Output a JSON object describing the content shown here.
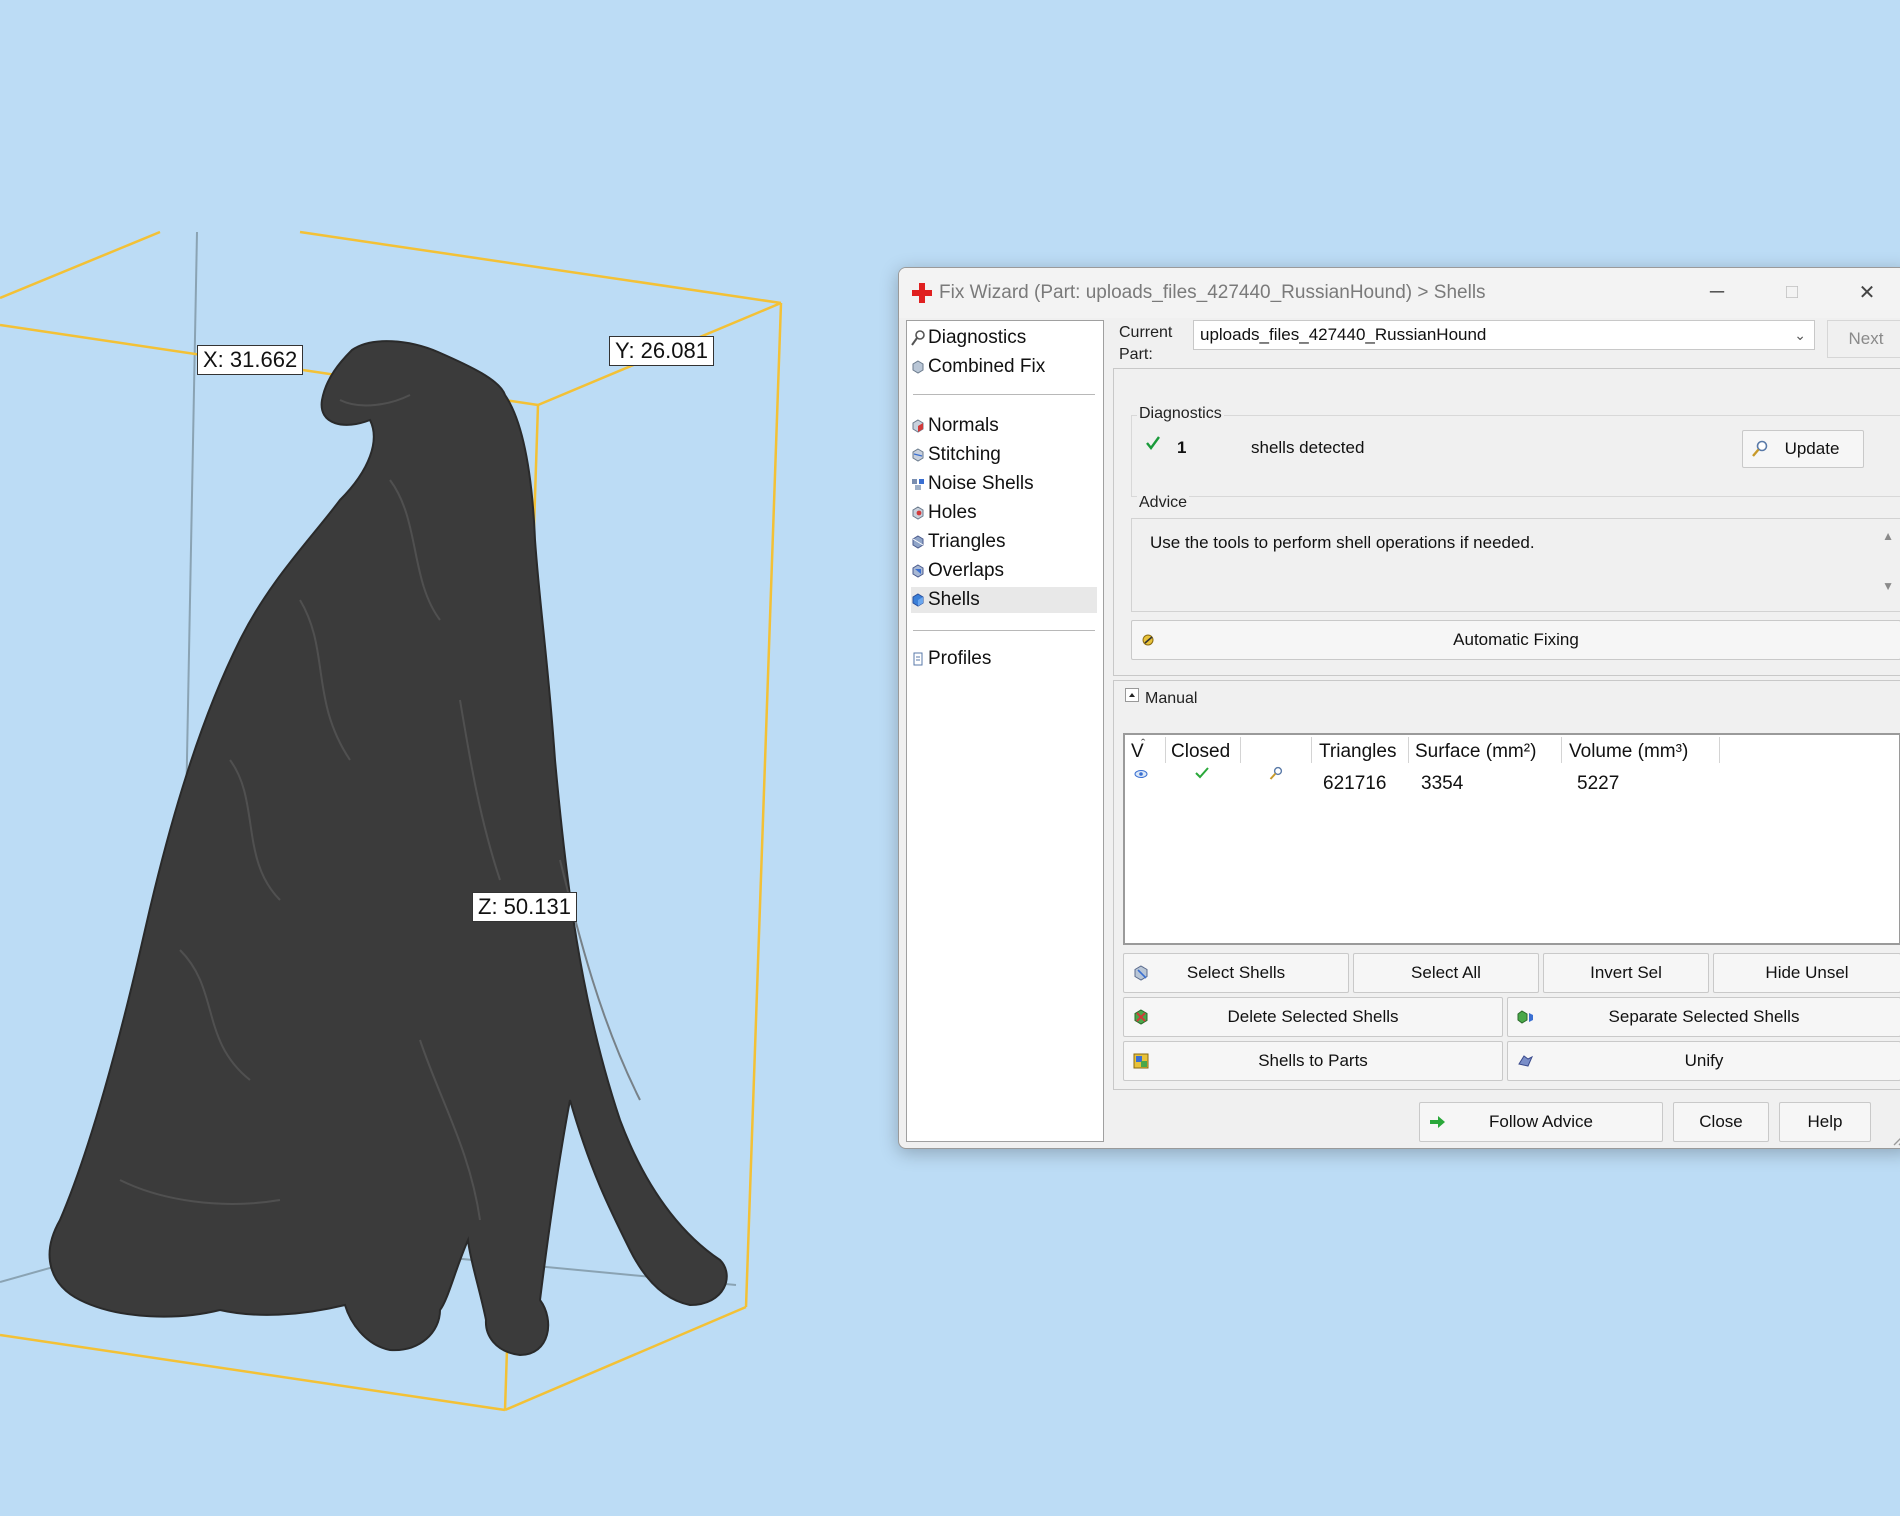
{
  "viewport": {
    "dimensions": {
      "x": "X: 31.662",
      "y": "Y: 26.081",
      "z": "Z: 50.131"
    },
    "bbox_color": "#f3c136",
    "model": "dog-sculpture"
  },
  "window": {
    "title": "Fix Wizard (Part: uploads_files_427440_RussianHound) > Shells",
    "title_icon": "red-cross-icon",
    "controls": {
      "minimize": "─",
      "maximize": "□",
      "close": "✕"
    }
  },
  "nav": {
    "items": [
      {
        "label": "Diagnostics",
        "icon": "magnifier-icon"
      },
      {
        "label": "Combined Fix",
        "icon": "cube-icon"
      },
      {
        "label": "Normals",
        "icon": "normals-icon"
      },
      {
        "label": "Stitching",
        "icon": "stitching-icon"
      },
      {
        "label": "Noise Shells",
        "icon": "noise-shells-icon"
      },
      {
        "label": "Holes",
        "icon": "holes-icon"
      },
      {
        "label": "Triangles",
        "icon": "triangles-icon"
      },
      {
        "label": "Overlaps",
        "icon": "overlaps-icon"
      },
      {
        "label": "Shells",
        "icon": "shells-icon",
        "selected": true
      },
      {
        "label": "Profiles",
        "icon": "profiles-icon"
      }
    ]
  },
  "current_part": {
    "label": "Current Part:",
    "value": "uploads_files_427440_RussianHound",
    "next_label": "Next"
  },
  "diagnostics": {
    "group_label": "Diagnostics",
    "count": "1",
    "status_text": "shells detected",
    "update_label": "Update"
  },
  "advice": {
    "group_label": "Advice",
    "text": "Use the tools to perform shell operations if needed."
  },
  "automatic_fixing_label": "Automatic Fixing",
  "manual": {
    "group_label": "Manual",
    "columns": [
      "V",
      "Closed",
      "",
      "Triangles",
      "Surface (mm²)",
      "Volume (mm³)"
    ],
    "rows": [
      {
        "visible": "eye-icon",
        "closed": "check-icon",
        "action": "magnifier-icon",
        "triangles": "621716",
        "surface": "3354",
        "volume": "5227"
      }
    ]
  },
  "buttons": {
    "select_shells": "Select Shells",
    "select_all": "Select All",
    "invert_sel": "Invert Sel",
    "hide_unsel": "Hide Unsel",
    "delete_selected": "Delete Selected Shells",
    "separate_selected": "Separate Selected Shells",
    "shells_to_parts": "Shells to Parts",
    "unify": "Unify",
    "follow_advice": "Follow Advice",
    "close": "Close",
    "help": "Help"
  }
}
